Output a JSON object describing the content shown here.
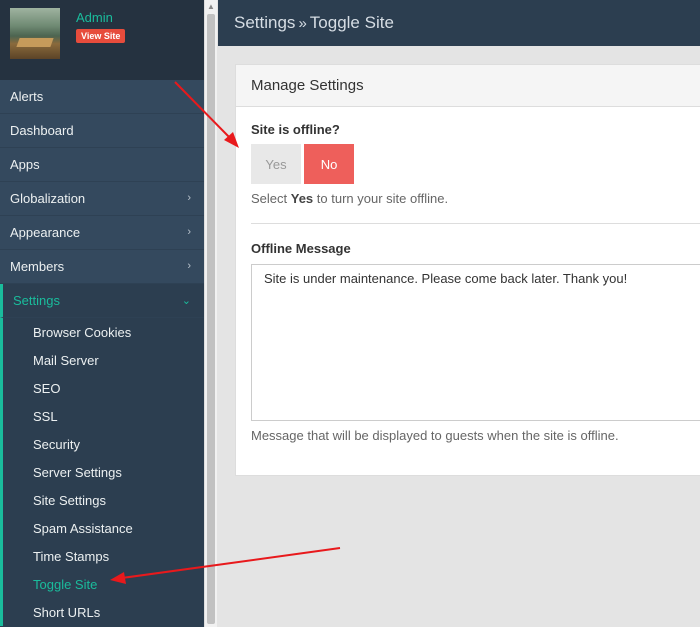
{
  "profile": {
    "name": "Admin",
    "view_site": "View Site"
  },
  "sidebar": {
    "items": [
      {
        "label": "Alerts"
      },
      {
        "label": "Dashboard"
      },
      {
        "label": "Apps"
      },
      {
        "label": "Globalization",
        "chevron": "›"
      },
      {
        "label": "Appearance",
        "chevron": "›"
      },
      {
        "label": "Members",
        "chevron": "›"
      },
      {
        "label": "Settings",
        "chevron": "⌄"
      }
    ],
    "settings_sub": [
      "Browser Cookies",
      "Mail Server",
      "SEO",
      "SSL",
      "Security",
      "Server Settings",
      "Site Settings",
      "Spam Assistance",
      "Time Stamps",
      "Toggle Site",
      "Short URLs"
    ]
  },
  "header": {
    "section": "Settings",
    "separator": "»",
    "page": "Toggle Site"
  },
  "panel": {
    "title": "Manage Settings",
    "offline_label": "Site is offline?",
    "yes": "Yes",
    "no": "No",
    "help_prefix": "Select ",
    "help_bold": "Yes",
    "help_suffix": " to turn your site offline.",
    "message_label": "Offline Message",
    "message_value": "Site is under maintenance. Please come back later. Thank you!",
    "message_help": "Message that will be displayed to guests when the site is offline."
  },
  "colors": {
    "accent": "#1abc9c",
    "danger": "#ee5f5b",
    "sidebar": "#2c3e50",
    "annotation": "#e8191c"
  }
}
